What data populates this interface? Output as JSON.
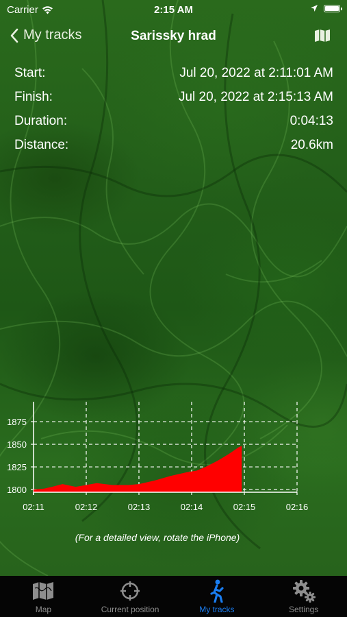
{
  "status_bar": {
    "carrier": "Carrier",
    "time": "2:15 AM"
  },
  "nav": {
    "back_label": "My tracks",
    "title": "Sarissky hrad"
  },
  "track_info": [
    {
      "label": "Start:",
      "value": "Jul 20, 2022 at 2:11:01 AM"
    },
    {
      "label": "Finish:",
      "value": "Jul 20, 2022 at 2:15:13 AM"
    },
    {
      "label": "Duration:",
      "value": "0:04:13"
    },
    {
      "label": "Distance:",
      "value": "20.6km"
    }
  ],
  "chart_data": {
    "type": "area",
    "x_ticks": [
      "02:11",
      "02:12",
      "02:13",
      "02:14",
      "02:15",
      "02:16"
    ],
    "y_ticks": [
      1800,
      1825,
      1850,
      1875
    ],
    "ylim": [
      1797,
      1897
    ],
    "xlim_minutes": [
      0,
      5
    ],
    "grid": true,
    "color": "#ff0000",
    "series": [
      {
        "x_minutes": [
          0,
          0.2,
          0.35,
          0.55,
          0.8,
          1.0,
          1.2,
          1.5,
          1.8,
          2.0,
          2.3,
          2.6,
          2.9,
          3.1,
          3.3,
          3.5,
          3.7,
          3.9,
          3.95,
          3.95
        ],
        "y": [
          1800,
          1801,
          1803,
          1806,
          1803,
          1805,
          1807,
          1805,
          1805,
          1806,
          1810,
          1815,
          1819,
          1821,
          1826,
          1832,
          1839,
          1847,
          1848,
          1800
        ]
      }
    ]
  },
  "chart_note": "(For a detailed view, rotate the iPhone)",
  "tabs": [
    {
      "label": "Map",
      "icon": "map-icon",
      "active": false
    },
    {
      "label": "Current position",
      "icon": "crosshair-icon",
      "active": false
    },
    {
      "label": "My tracks",
      "icon": "walking-person-icon",
      "active": true
    },
    {
      "label": "Settings",
      "icon": "gears-icon",
      "active": false
    }
  ],
  "colors": {
    "accent": "#1a7df0",
    "chart_fill": "#ff0000",
    "tab_inactive": "#8e8e8e",
    "tab_bar_bg": "#050505"
  }
}
